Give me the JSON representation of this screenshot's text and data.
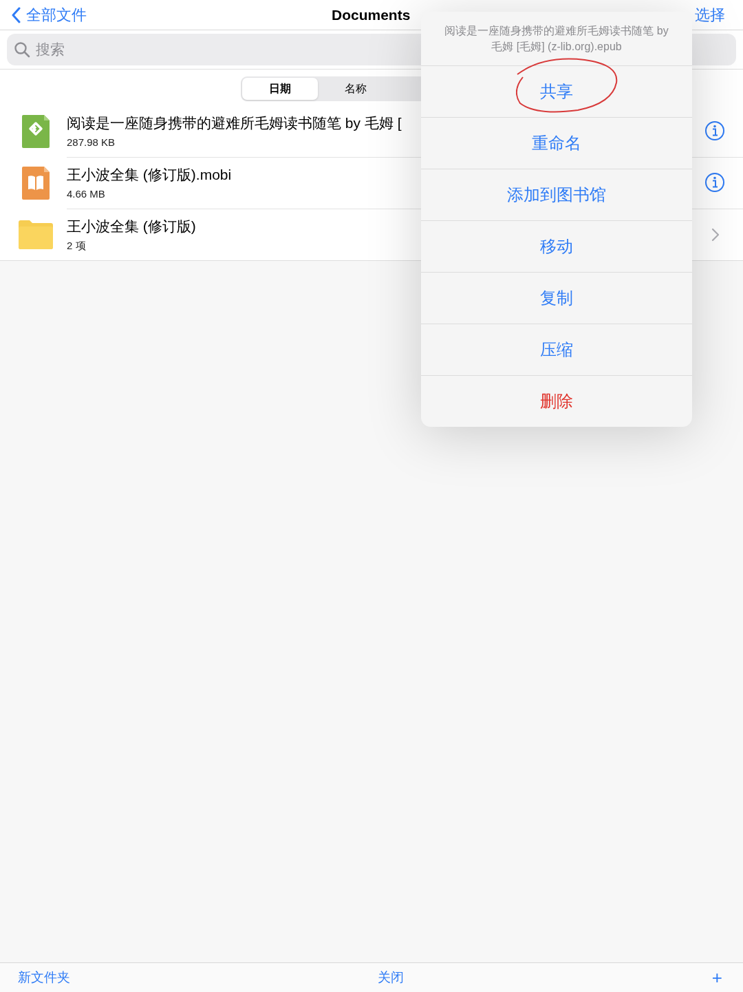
{
  "nav": {
    "back_label": "全部文件",
    "title": "Documents",
    "action": "选择"
  },
  "search": {
    "placeholder": "搜索"
  },
  "sort_tabs": [
    {
      "label": "日期",
      "selected": true
    },
    {
      "label": "名称",
      "selected": false
    }
  ],
  "files": [
    {
      "kind": "epub",
      "name": "阅读是一座随身携带的避难所毛姆读书随笔 by 毛姆 [",
      "detail": "287.98 KB",
      "info_button": true
    },
    {
      "kind": "book",
      "name": "王小波全集 (修订版).mobi",
      "detail": "4.66 MB",
      "info_button": true
    },
    {
      "kind": "folder",
      "name": "王小波全集 (修订版)",
      "detail": "2 项",
      "info_button": false
    }
  ],
  "action_sheet": {
    "title": "阅读是一座随身携带的避难所毛姆读书随笔 by 毛姆 [毛姆] (z-lib.org).epub",
    "actions": [
      {
        "label": "共享",
        "kind": "action",
        "circled": true
      },
      {
        "label": "重命名",
        "kind": "action",
        "circled": false
      },
      {
        "label": "添加到图书馆",
        "kind": "action",
        "circled": false
      },
      {
        "label": "移动",
        "kind": "action",
        "circled": false
      },
      {
        "label": "复制",
        "kind": "action",
        "circled": false
      },
      {
        "label": "压缩",
        "kind": "action",
        "circled": false
      },
      {
        "label": "删除",
        "kind": "destructive",
        "circled": false
      }
    ]
  },
  "toolbar": {
    "left": "新文件夹",
    "center": "关闭",
    "right": "+"
  }
}
